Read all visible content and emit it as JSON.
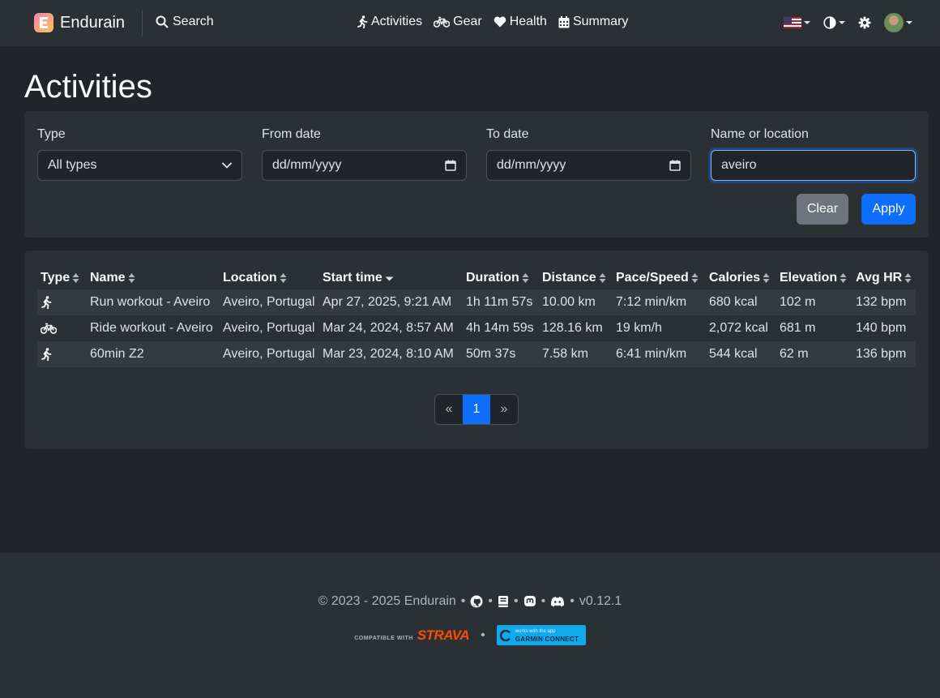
{
  "navbar": {
    "brand": "Endurain",
    "search_label": "Search",
    "links": [
      "Activities",
      "Gear",
      "Health",
      "Summary"
    ]
  },
  "page": {
    "title": "Activities"
  },
  "filters": {
    "type_label": "Type",
    "type_value": "All types",
    "from_label": "From date",
    "from_placeholder": "dd/mm/yyyy",
    "to_label": "To date",
    "to_placeholder": "dd/mm/yyyy",
    "name_label": "Name or location",
    "name_value": "aveiro",
    "clear_label": "Clear",
    "apply_label": "Apply"
  },
  "table": {
    "columns": [
      "Type",
      "Name",
      "Location",
      "Start time",
      "Duration",
      "Distance",
      "Pace/Speed",
      "Calories",
      "Elevation",
      "Avg HR"
    ],
    "rows": [
      {
        "type_icon": "run-icon",
        "name": "Run workout - Aveiro",
        "location": "Aveiro, Portugal",
        "start": "Apr 27, 2025, 9:21 AM",
        "duration": "1h 11m 57s",
        "distance": "10.00 km",
        "pace": "7:12 min/km",
        "calories": "680 kcal",
        "elevation": "102 m",
        "hr": "132 bpm"
      },
      {
        "type_icon": "bike-icon",
        "name": "Ride workout - Aveiro",
        "location": "Aveiro, Portugal",
        "start": "Mar 24, 2024, 8:57 AM",
        "duration": "4h 14m 59s",
        "distance": "128.16 km",
        "pace": "19 km/h",
        "calories": "2,072 kcal",
        "elevation": "681 m",
        "hr": "140 bpm"
      },
      {
        "type_icon": "run-icon",
        "name": "60min Z2",
        "location": "Aveiro, Portugal",
        "start": "Mar 23, 2024, 8:10 AM",
        "duration": "50m 37s",
        "distance": "7.58 km",
        "pace": "6:41 min/km",
        "calories": "544 kcal",
        "elevation": "62 m",
        "hr": "136 bpm"
      }
    ]
  },
  "pagination": {
    "prev": "«",
    "current": "1",
    "next": "»"
  },
  "footer": {
    "copyright": "© 2023 - 2025 Endurain",
    "separator": "•",
    "version": "v0.12.1",
    "strava_small": "COMPATIBLE WITH",
    "strava_big": "STRAVA",
    "garmin_small": "works with the app",
    "garmin_big": "GARMIN CONNECT"
  },
  "colors": {
    "primary": "#0d6efd",
    "background": "#212529",
    "surface": "#2b3035",
    "strava": "#fc4c02",
    "garmin": "#11a9ed"
  }
}
